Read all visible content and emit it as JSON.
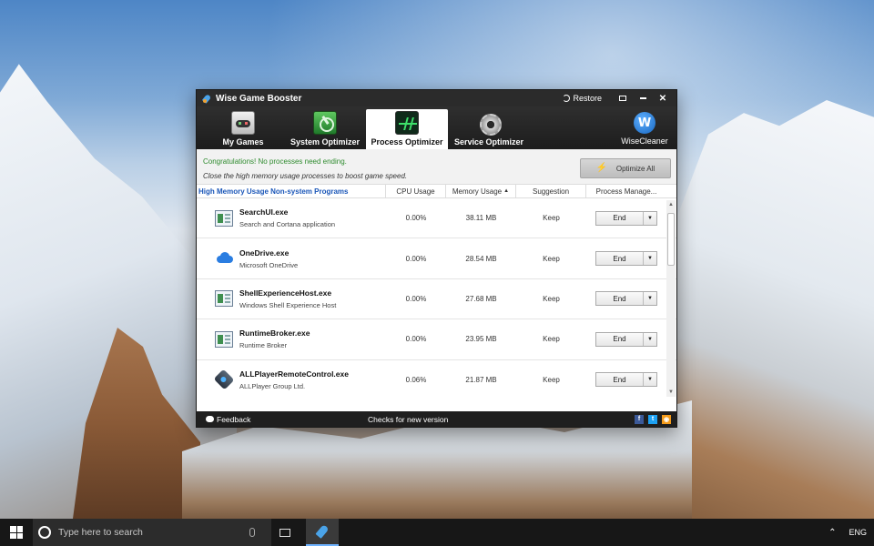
{
  "window": {
    "title": "Wise Game Booster",
    "restore_label": "Restore"
  },
  "tabs": [
    {
      "label": "My Games",
      "icon": "gamepad-icon"
    },
    {
      "label": "System Optimizer",
      "icon": "speedometer-icon"
    },
    {
      "label": "Process Optimizer",
      "icon": "pulse-monitor-icon",
      "active": true
    },
    {
      "label": "Service Optimizer",
      "icon": "gear-icon"
    }
  ],
  "brand": {
    "label": "WiseCleaner",
    "logo_letter": "W"
  },
  "info": {
    "success_message": "Congratulations! No processes need ending.",
    "tip_message": "Close the high memory usage processes to boost game speed.",
    "optimize_label": "Optimize All"
  },
  "table": {
    "headers": {
      "name": "High Memory Usage Non-system Programs",
      "cpu": "CPU Usage",
      "memory": "Memory Usage",
      "suggestion": "Suggestion",
      "manage": "Process Manage..."
    },
    "sort_indicator": "▲",
    "end_label": "End",
    "rows": [
      {
        "name": "SearchUI.exe",
        "desc": "Search and Cortana application",
        "cpu": "0.00%",
        "memory": "38.11 MB",
        "suggestion": "Keep",
        "icon": "window-app-icon"
      },
      {
        "name": "OneDrive.exe",
        "desc": "Microsoft OneDrive",
        "cpu": "0.00%",
        "memory": "28.54 MB",
        "suggestion": "Keep",
        "icon": "cloud-icon"
      },
      {
        "name": "ShellExperienceHost.exe",
        "desc": "Windows Shell Experience Host",
        "cpu": "0.00%",
        "memory": "27.68 MB",
        "suggestion": "Keep",
        "icon": "window-app-icon"
      },
      {
        "name": "RuntimeBroker.exe",
        "desc": "Runtime Broker",
        "cpu": "0.00%",
        "memory": "23.95 MB",
        "suggestion": "Keep",
        "icon": "window-app-icon"
      },
      {
        "name": "ALLPlayerRemoteControl.exe",
        "desc": "ALLPlayer Group Ltd.",
        "cpu": "0.06%",
        "memory": "21.87 MB",
        "suggestion": "Keep",
        "icon": "player-icon"
      }
    ]
  },
  "status": {
    "feedback_label": "Feedback",
    "checks_label": "Checks for new version",
    "social": [
      "f",
      "t",
      "rss"
    ]
  },
  "taskbar": {
    "search_placeholder": "Type here to search",
    "language": "ENG"
  }
}
